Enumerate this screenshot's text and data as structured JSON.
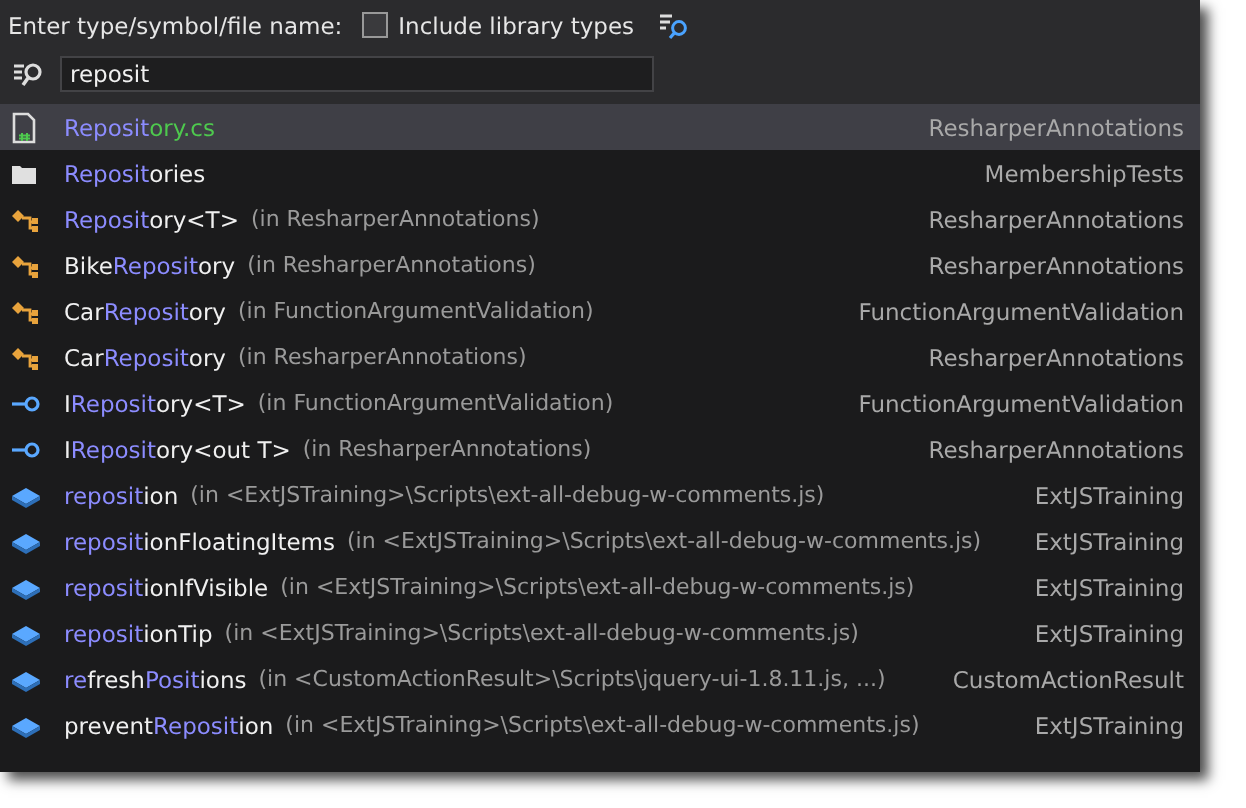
{
  "search_label": "Enter type/symbol/file name:",
  "include_library": {
    "label": "Include library types",
    "checked": false
  },
  "search": {
    "value": "reposit"
  },
  "results": [
    {
      "kind": "file",
      "selected": true,
      "name": [
        {
          "text": "Reposit",
          "match": true
        },
        {
          "text": "ory.cs",
          "match": false
        }
      ],
      "project": "ResharperAnnotations"
    },
    {
      "kind": "folder",
      "selected": false,
      "name": [
        {
          "text": "Reposit",
          "match": true
        },
        {
          "text": "ories",
          "match": false
        }
      ],
      "project": "MembershipTests"
    },
    {
      "kind": "class",
      "selected": false,
      "name": [
        {
          "text": "Reposit",
          "match": true
        },
        {
          "text": "ory<T>",
          "match": false
        }
      ],
      "location": "(in ResharperAnnotations)",
      "project": "ResharperAnnotations"
    },
    {
      "kind": "class",
      "selected": false,
      "name": [
        {
          "text": "Bike",
          "match": false
        },
        {
          "text": "Reposit",
          "match": true
        },
        {
          "text": "ory",
          "match": false
        }
      ],
      "location": "(in ResharperAnnotations)",
      "project": "ResharperAnnotations"
    },
    {
      "kind": "class",
      "selected": false,
      "name": [
        {
          "text": "Car",
          "match": false
        },
        {
          "text": "Reposit",
          "match": true
        },
        {
          "text": "ory",
          "match": false
        }
      ],
      "location": "(in FunctionArgumentValidation)",
      "project": "FunctionArgumentValidation"
    },
    {
      "kind": "class",
      "selected": false,
      "name": [
        {
          "text": "Car",
          "match": false
        },
        {
          "text": "Reposit",
          "match": true
        },
        {
          "text": "ory",
          "match": false
        }
      ],
      "location": "(in ResharperAnnotations)",
      "project": "ResharperAnnotations"
    },
    {
      "kind": "interface",
      "selected": false,
      "name": [
        {
          "text": "I",
          "match": false
        },
        {
          "text": "Reposit",
          "match": true
        },
        {
          "text": "ory<T>",
          "match": false
        }
      ],
      "location": "(in FunctionArgumentValidation)",
      "project": "FunctionArgumentValidation"
    },
    {
      "kind": "interface",
      "selected": false,
      "name": [
        {
          "text": "I",
          "match": false
        },
        {
          "text": "Reposit",
          "match": true
        },
        {
          "text": "ory<out T>",
          "match": false
        }
      ],
      "location": "(in ResharperAnnotations)",
      "project": "ResharperAnnotations"
    },
    {
      "kind": "method",
      "selected": false,
      "name": [
        {
          "text": "reposit",
          "match": true
        },
        {
          "text": "ion",
          "match": false
        }
      ],
      "location": "(in <ExtJSTraining>\\Scripts\\ext-all-debug-w-comments.js)",
      "project": "ExtJSTraining"
    },
    {
      "kind": "method",
      "selected": false,
      "name": [
        {
          "text": "reposit",
          "match": true
        },
        {
          "text": "ionFloatingItems",
          "match": false
        }
      ],
      "location": "(in <ExtJSTraining>\\Scripts\\ext-all-debug-w-comments.js)",
      "project": "ExtJSTraining"
    },
    {
      "kind": "method",
      "selected": false,
      "name": [
        {
          "text": "reposit",
          "match": true
        },
        {
          "text": "ionIfVisible",
          "match": false
        }
      ],
      "location": "(in <ExtJSTraining>\\Scripts\\ext-all-debug-w-comments.js)",
      "project": "ExtJSTraining"
    },
    {
      "kind": "method",
      "selected": false,
      "name": [
        {
          "text": "reposit",
          "match": true
        },
        {
          "text": "ionTip",
          "match": false
        }
      ],
      "location": "(in <ExtJSTraining>\\Scripts\\ext-all-debug-w-comments.js)",
      "project": "ExtJSTraining"
    },
    {
      "kind": "method",
      "selected": false,
      "name": [
        {
          "text": "re",
          "match": true
        },
        {
          "text": "fresh",
          "match": false
        },
        {
          "text": "Posit",
          "match": true
        },
        {
          "text": "ions",
          "match": false
        }
      ],
      "location": "(in <CustomActionResult>\\Scripts\\jquery-ui-1.8.11.js, ...)",
      "project": "CustomActionResult"
    },
    {
      "kind": "method",
      "selected": false,
      "name": [
        {
          "text": "prevent",
          "match": false
        },
        {
          "text": "Reposit",
          "match": true
        },
        {
          "text": "ion",
          "match": false
        }
      ],
      "location": "(in <ExtJSTraining>\\Scripts\\ext-all-debug-w-comments.js)",
      "project": "ExtJSTraining"
    }
  ]
}
